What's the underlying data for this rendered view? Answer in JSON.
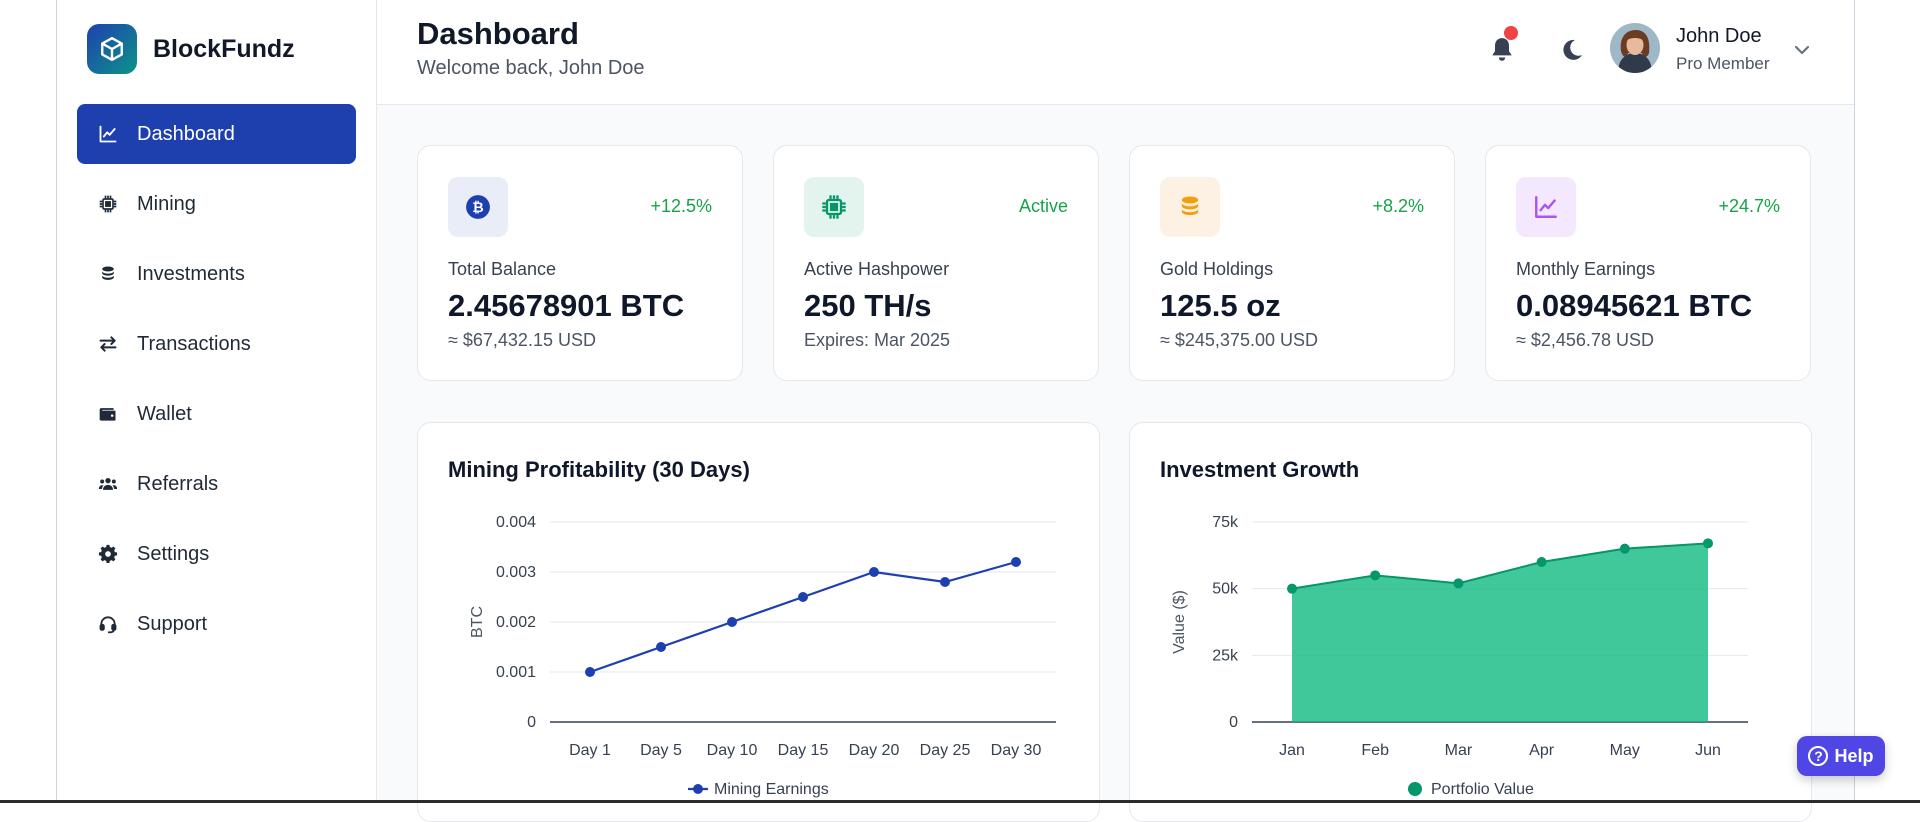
{
  "brand": {
    "name": "BlockFundz"
  },
  "sidebar": {
    "items": [
      {
        "label": "Dashboard",
        "icon": "chart-line-icon",
        "active": true
      },
      {
        "label": "Mining",
        "icon": "chip-icon"
      },
      {
        "label": "Investments",
        "icon": "coins-icon"
      },
      {
        "label": "Transactions",
        "icon": "exchange-icon"
      },
      {
        "label": "Wallet",
        "icon": "wallet-icon"
      },
      {
        "label": "Referrals",
        "icon": "users-icon"
      },
      {
        "label": "Settings",
        "icon": "gear-icon"
      },
      {
        "label": "Support",
        "icon": "headset-icon"
      }
    ]
  },
  "header": {
    "title": "Dashboard",
    "subtitle": "Welcome back, John Doe",
    "user": {
      "name": "John Doe",
      "role": "Pro Member"
    }
  },
  "stats": [
    {
      "label": "Total Balance",
      "value": "2.45678901 BTC",
      "sub": "≈ $67,432.15 USD",
      "badge": "+12.5%",
      "icon": "bitcoin-icon",
      "icon_bg": "#e8edf7",
      "icon_color": "#1e40af"
    },
    {
      "label": "Active Hashpower",
      "value": "250 TH/s",
      "sub": "Expires: Mar 2025",
      "badge": "Active",
      "icon": "chip-icon",
      "icon_bg": "#e3f4ee",
      "icon_color": "#059669"
    },
    {
      "label": "Gold Holdings",
      "value": "125.5 oz",
      "sub": "≈ $245,375.00 USD",
      "badge": "+8.2%",
      "icon": "coins-icon",
      "icon_bg": "#fdf1e3",
      "icon_color": "#f59e0b"
    },
    {
      "label": "Monthly Earnings",
      "value": "0.08945621 BTC",
      "sub": "≈ $2,456.78 USD",
      "badge": "+24.7%",
      "icon": "chart-line-icon",
      "icon_bg": "#f3e8fd",
      "icon_color": "#a855f7"
    }
  ],
  "chart_data": [
    {
      "type": "line",
      "title": "Mining Profitability (30 Days)",
      "ylabel": "BTC",
      "xlabel": "",
      "categories": [
        "Day 1",
        "Day 5",
        "Day 10",
        "Day 15",
        "Day 20",
        "Day 25",
        "Day 30"
      ],
      "series": [
        {
          "name": "Mining Earnings",
          "values": [
            0.001,
            0.0015,
            0.002,
            0.0025,
            0.003,
            0.0028,
            0.0032
          ],
          "color": "#1e40af"
        }
      ],
      "ylim": [
        0,
        0.004
      ],
      "yticks": [
        "0",
        "0.001",
        "0.002",
        "0.003",
        "0.004"
      ],
      "grid": true,
      "legend": "bottom"
    },
    {
      "type": "area",
      "title": "Investment Growth",
      "ylabel": "Value ($)",
      "xlabel": "",
      "categories": [
        "Jan",
        "Feb",
        "Mar",
        "Apr",
        "May",
        "Jun"
      ],
      "series": [
        {
          "name": "Portfolio Value",
          "values": [
            50000,
            55000,
            52000,
            60000,
            65000,
            67000
          ],
          "color": "#10b981"
        }
      ],
      "ylim": [
        0,
        75000
      ],
      "yticks": [
        "0",
        "25k",
        "50k",
        "75k"
      ],
      "grid": true,
      "legend": "bottom"
    }
  ],
  "help": {
    "label": "Help"
  }
}
